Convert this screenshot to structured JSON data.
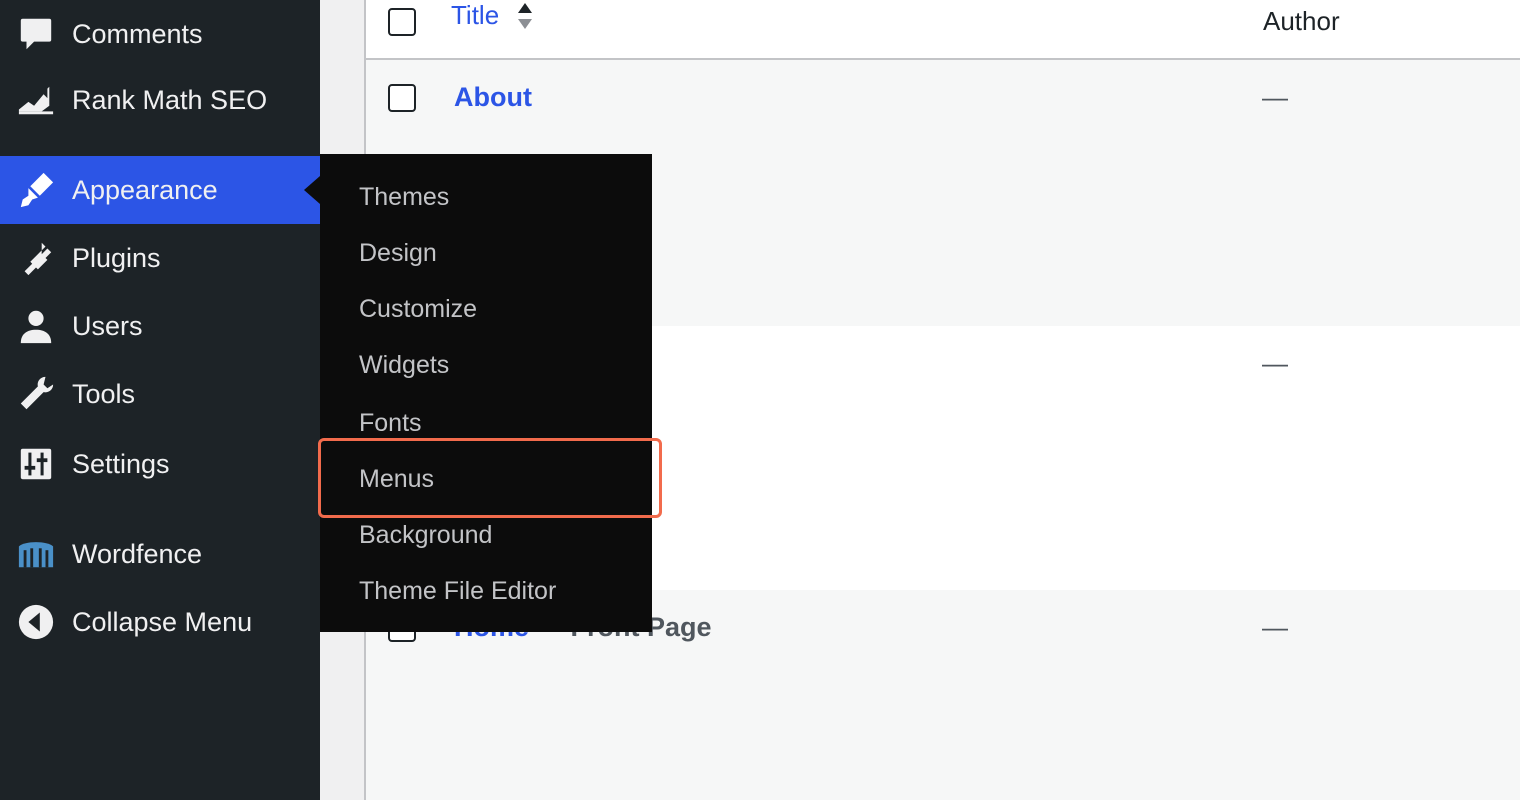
{
  "sidebar": {
    "items": [
      {
        "label": "Comments",
        "icon": "comment-icon"
      },
      {
        "label": "Rank Math SEO",
        "icon": "rank-math-icon"
      },
      {
        "label": "Appearance",
        "icon": "paintbrush-icon",
        "active": true
      },
      {
        "label": "Plugins",
        "icon": "plugin-icon"
      },
      {
        "label": "Users",
        "icon": "user-icon"
      },
      {
        "label": "Tools",
        "icon": "wrench-icon"
      },
      {
        "label": "Settings",
        "icon": "settings-sliders-icon"
      },
      {
        "label": "Wordfence",
        "icon": "wordfence-icon"
      },
      {
        "label": "Collapse Menu",
        "icon": "collapse-arrow-icon"
      }
    ]
  },
  "flyout": {
    "items": [
      {
        "label": "Themes"
      },
      {
        "label": "Design"
      },
      {
        "label": "Customize"
      },
      {
        "label": "Widgets"
      },
      {
        "label": "Fonts"
      },
      {
        "label": "Menus",
        "highlighted": true
      },
      {
        "label": "Background"
      },
      {
        "label": "Theme File Editor"
      }
    ]
  },
  "table": {
    "columns": {
      "title": "Title",
      "author": "Author"
    },
    "rows": [
      {
        "title": "About",
        "author": "—"
      },
      {
        "title": "",
        "author": "—"
      },
      {
        "title": "Home",
        "state": "— Front Page",
        "author": "—"
      }
    ]
  },
  "colors": {
    "sidebar_bg": "#1d2327",
    "accent": "#2c55e6",
    "flyout_bg": "#0c0c0c",
    "highlight_border": "#f26b4c"
  }
}
